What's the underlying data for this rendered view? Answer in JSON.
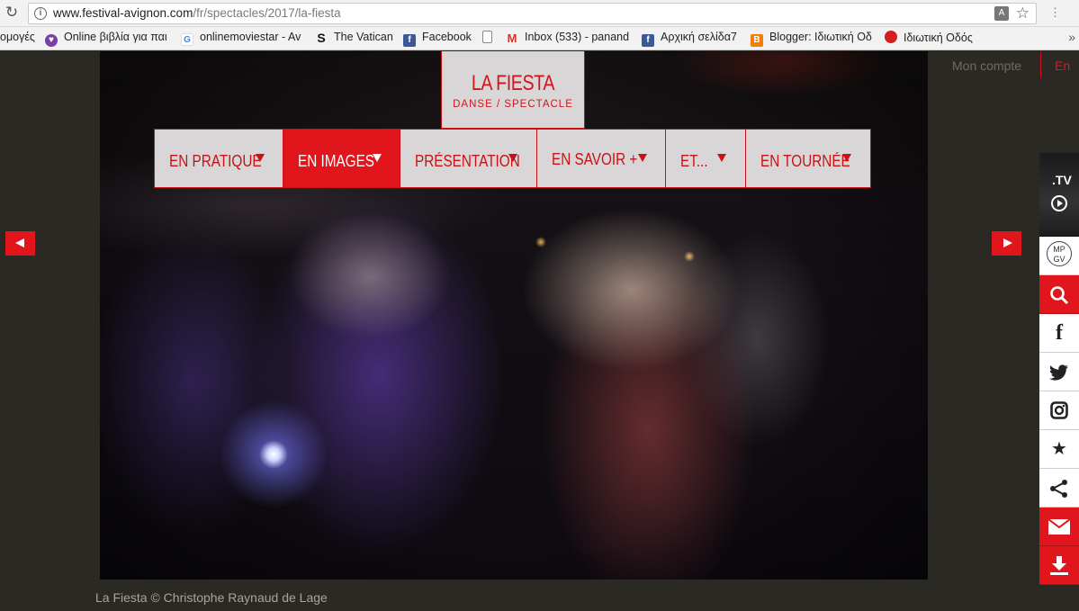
{
  "browser": {
    "url_domain": "www.festival-avignon.com",
    "url_path": "/fr/spectacles/2017/la-fiesta",
    "bookmarks": [
      {
        "label": "ομογές",
        "icon": "none"
      },
      {
        "label": "Online βιβλία για παι",
        "icon": "heart-icon"
      },
      {
        "label": "onlinemoviestar - Av",
        "icon": "google-icon"
      },
      {
        "label": "The Vatican",
        "icon": "s-icon"
      },
      {
        "label": "Facebook",
        "icon": "facebook-icon"
      },
      {
        "label": "",
        "icon": "page-icon"
      },
      {
        "label": "Inbox (533) - panand",
        "icon": "gmail-icon"
      },
      {
        "label": "Αρχική σελίδα7",
        "icon": "facebook-icon"
      },
      {
        "label": "Blogger: Ιδιωτική Οδ",
        "icon": "blogger-icon"
      },
      {
        "label": "Ιδιωτική Οδός",
        "icon": "circle-icon"
      }
    ]
  },
  "header": {
    "title": "LA FIESTA",
    "subtitle": "DANSE / SPECTACLE",
    "account": "Mon compte",
    "lang": "En"
  },
  "nav": [
    {
      "label": "EN PRATIQUE",
      "active": false
    },
    {
      "label": "EN IMAGES",
      "active": true
    },
    {
      "label": "PRÉSENTATION",
      "active": false
    },
    {
      "label": "EN SAVOIR +",
      "active": false
    },
    {
      "label": "ET...",
      "active": false
    },
    {
      "label": "EN TOURNÉE",
      "active": false
    }
  ],
  "side": {
    "tv_label": ".TV",
    "logo_text": "MP\nGV"
  },
  "caption": "La Fiesta © Christophe Raynaud de Lage",
  "colors": {
    "accent": "#e0161c",
    "nav_bg": "#d8d6d6",
    "page_bg": "#2b2924"
  }
}
